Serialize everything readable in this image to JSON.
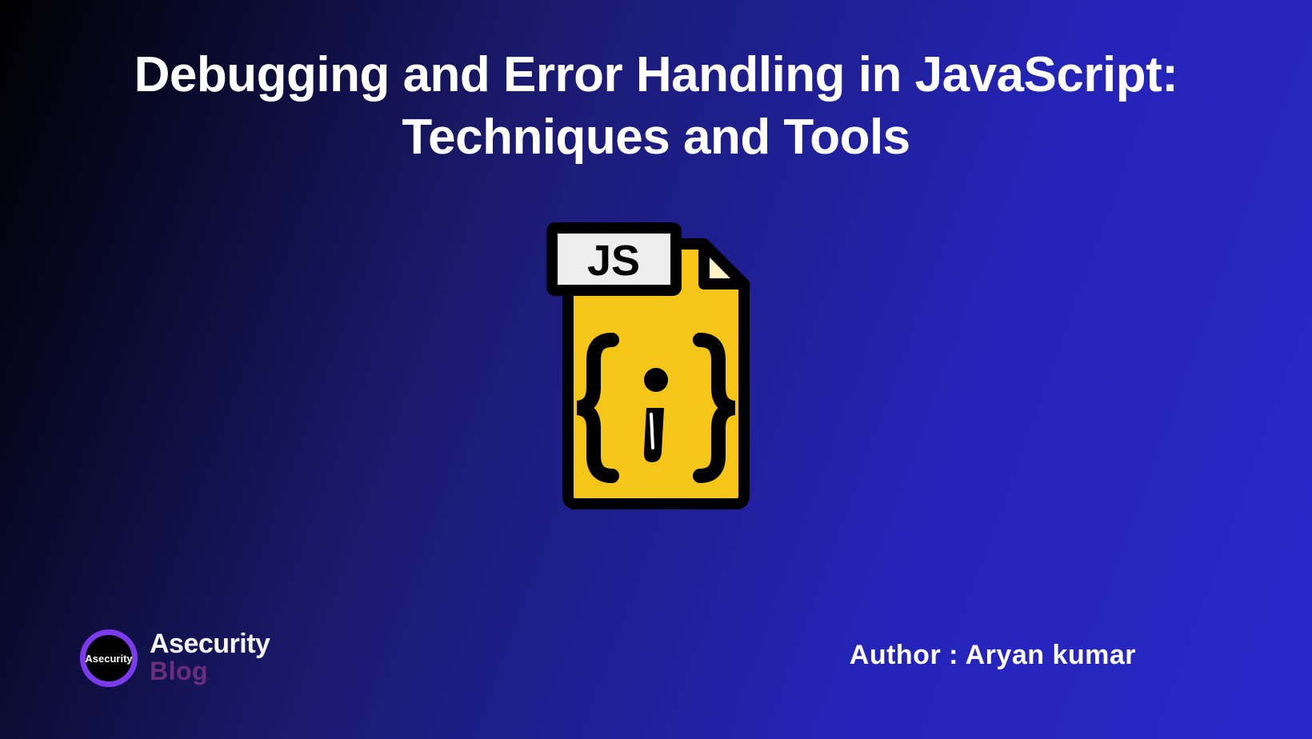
{
  "title": "Debugging and Error Handling in JavaScript: Techniques and Tools",
  "icon": {
    "label": "JS",
    "symbol": "i"
  },
  "logo": {
    "circleText": "Asecurity",
    "topText": "Asecurity",
    "bottomText": "Blog"
  },
  "author": "Author : Aryan kumar"
}
